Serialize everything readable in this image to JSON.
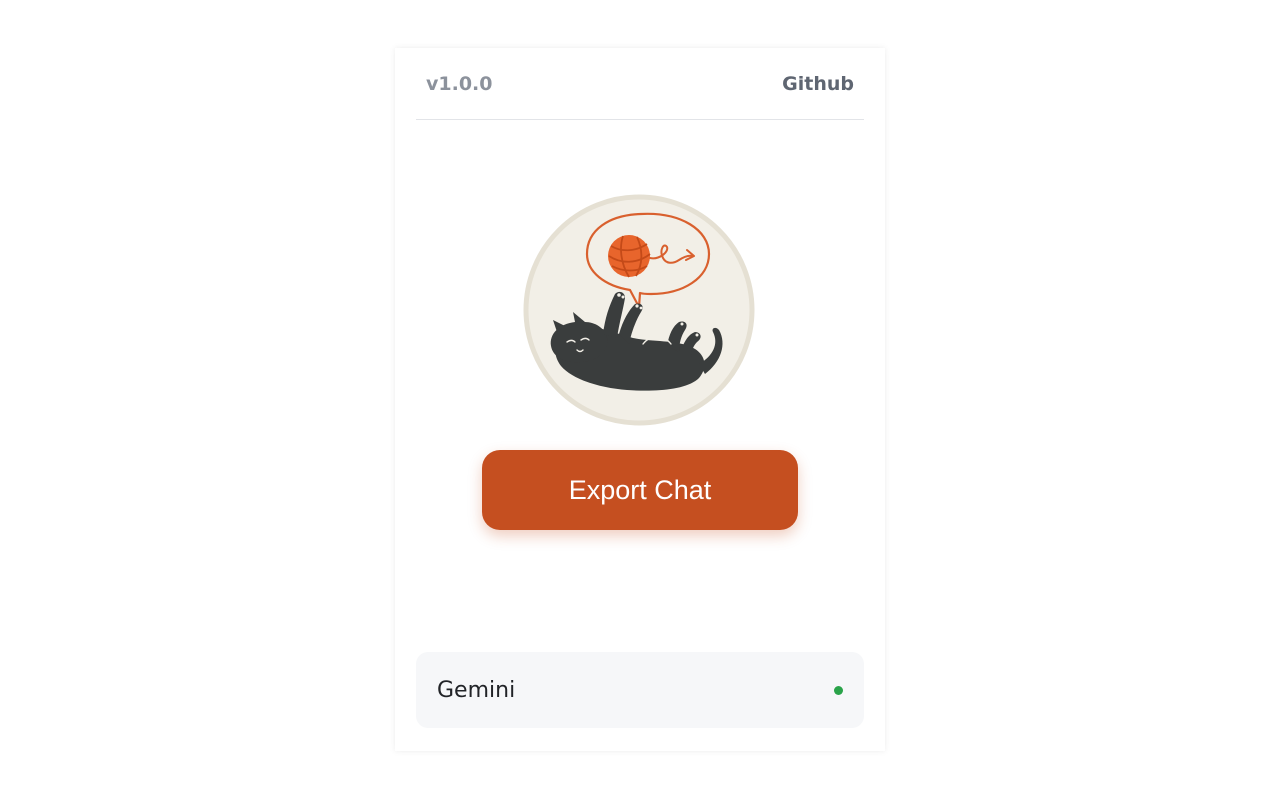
{
  "header": {
    "version": "v1.0.0",
    "github_label": "Github"
  },
  "logo": {
    "icon": "cat-playing-yarn-logo"
  },
  "main": {
    "export_label": "Export Chat"
  },
  "status": {
    "platform": "Gemini",
    "indicator": "connected-dot"
  },
  "colors": {
    "accent": "#c54f20",
    "status_ok": "#2aa34a",
    "logo_bg": "#f2efe7",
    "logo_ring": "#e5e0d3",
    "cat": "#3a3d3d",
    "yarn": "#e8652c"
  }
}
